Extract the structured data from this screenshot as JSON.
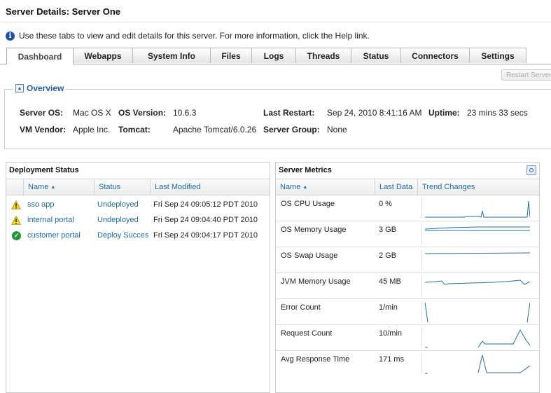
{
  "page": {
    "title": "Server Details: Server One",
    "info_text": "Use these tabs to view and edit details for this server. For more information, click the Help link."
  },
  "tabs": [
    {
      "label": "Dashboard",
      "active": true
    },
    {
      "label": "Webapps"
    },
    {
      "label": "System Info"
    },
    {
      "label": "Files"
    },
    {
      "label": "Logs"
    },
    {
      "label": "Threads"
    },
    {
      "label": "Status"
    },
    {
      "label": "Connectors"
    },
    {
      "label": "Settings"
    }
  ],
  "toolbar": {
    "restart_label": "Restart Server"
  },
  "overview": {
    "label": "Overview",
    "server_os_label": "Server OS:",
    "server_os": "Mac OS X",
    "os_version_label": "OS Version:",
    "os_version": "10.6.3",
    "last_restart_label": "Last Restart:",
    "last_restart": "Sep 24, 2010 8:41:16 AM",
    "uptime_label": "Uptime:",
    "uptime": "23 mins 33 secs",
    "vm_vendor_label": "VM Vendor:",
    "vm_vendor": "Apple Inc.",
    "tomcat_label": "Tomcat:",
    "tomcat": "Apache Tomcat/6.0.26",
    "server_group_label": "Server Group:",
    "server_group": "None"
  },
  "deployment": {
    "title": "Deployment Status",
    "columns": [
      "Name",
      "Status",
      "Last Modified"
    ],
    "rows": [
      {
        "status_icon": "warning-icon",
        "name": "sso app",
        "status": "Undeployed",
        "modified": "Fri Sep 24 09:05:12 PDT 2010"
      },
      {
        "status_icon": "warning-icon",
        "name": "internal portal",
        "status": "Undeployed",
        "modified": "Fri Sep 24 09:04:40 PDT 2010"
      },
      {
        "status_icon": "check-icon",
        "name": "customer portal",
        "status": "Deploy Succes",
        "modified": "Fri Sep 24 09:04:17 PDT 2010"
      }
    ]
  },
  "metrics": {
    "title": "Server Metrics",
    "columns": [
      "Name",
      "Last Data",
      "Trend Changes"
    ],
    "rows": [
      {
        "name": "OS CPU Usage",
        "value": "0 %"
      },
      {
        "name": "OS Memory Usage",
        "value": "3 GB"
      },
      {
        "name": "OS Swap Usage",
        "value": "2 GB"
      },
      {
        "name": "JVM Memory Usage",
        "value": "45 MB"
      },
      {
        "name": "Error Count",
        "value": "1/min"
      },
      {
        "name": "Request Count",
        "value": "10/min"
      },
      {
        "name": "Avg Response Time",
        "value": "171 ms"
      }
    ]
  },
  "colors": {
    "accent": "#1d6a9e",
    "warning": "#f2d21b",
    "success": "#1f9b34",
    "sparkline": "#1f6fa8"
  }
}
